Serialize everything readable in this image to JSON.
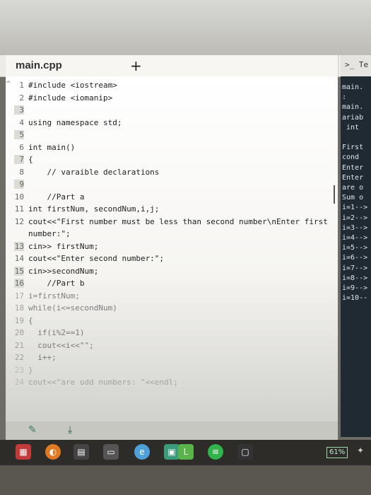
{
  "tab": {
    "title": "main.cpp",
    "add": "+"
  },
  "console_tab": {
    "label": ">_ Te"
  },
  "code": [
    {
      "num": "1",
      "text": "#include <iostream>"
    },
    {
      "num": "2",
      "text": "#include <iomanip>"
    },
    {
      "num": "3",
      "text": ""
    },
    {
      "num": "4",
      "text": "using namespace std;"
    },
    {
      "num": "5",
      "text": ""
    },
    {
      "num": "6",
      "text": "int main()"
    },
    {
      "num": "7",
      "text": "{"
    },
    {
      "num": "8",
      "text": "    // varaible declarations"
    },
    {
      "num": "9",
      "text": ""
    },
    {
      "num": "10",
      "text": "    //Part a"
    },
    {
      "num": "11",
      "text": "int firstNum, secondNum,i,j;"
    },
    {
      "num": "12",
      "text": "cout<<\"First number must be less than second number\\nEnter first"
    },
    {
      "num": "",
      "text": "number:\";"
    },
    {
      "num": "13",
      "text": "cin>> firstNum;"
    },
    {
      "num": "14",
      "text": "cout<<\"Enter second number:\";"
    },
    {
      "num": "15",
      "text": "cin>>secondNum;"
    },
    {
      "num": "16",
      "text": "    //Part b"
    },
    {
      "num": "17",
      "text": "i=firstNum;"
    },
    {
      "num": "18",
      "text": "while(i<=secondNum)"
    },
    {
      "num": "19",
      "text": "{"
    },
    {
      "num": "20",
      "text": "  if(i%2==1)"
    },
    {
      "num": "21",
      "text": "  cout<<i<<\"\";"
    },
    {
      "num": "22",
      "text": "  i++;"
    },
    {
      "num": "23",
      "text": "}"
    },
    {
      "num": "24",
      "text": "cout<<\"are odd numbers: \"<<endl;"
    }
  ],
  "console": [
    "main.",
    ":",
    "main.",
    "ariab",
    " int ",
    "",
    "First",
    "cond ",
    "Enter",
    "Enter",
    "are o",
    "Sum o",
    "i=1-->",
    "i=2-->",
    "i=3-->",
    "i=4-->",
    "i=5-->",
    "i=6-->",
    "i=7-->",
    "i=8-->",
    "i=9-->",
    "i=10--"
  ],
  "taskbar": {
    "battery": "61%"
  }
}
